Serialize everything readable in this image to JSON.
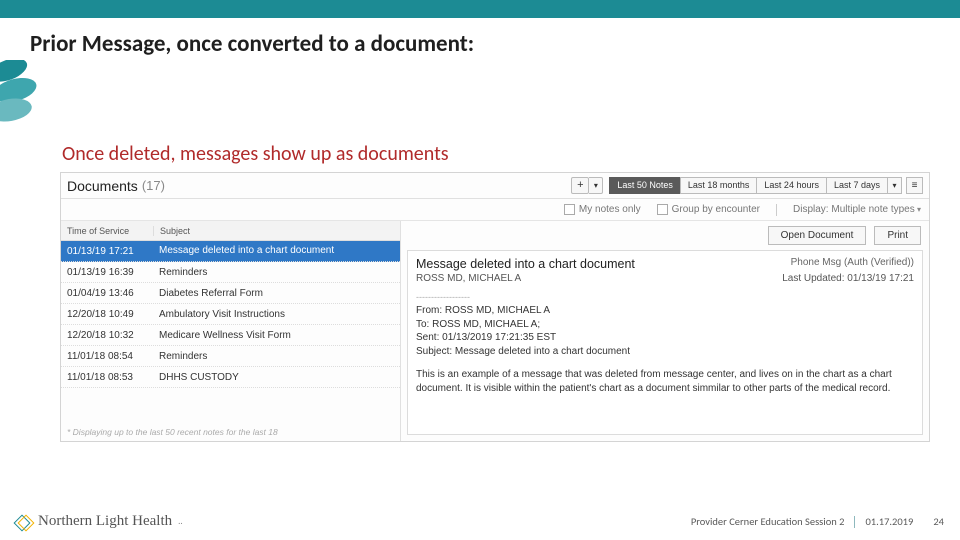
{
  "slide": {
    "title": "Prior Message, once converted to a document:",
    "subtitle": "Once deleted, messages show up as documents"
  },
  "docs_header": {
    "label": "Documents",
    "count": "(17)",
    "segments": [
      "Last 50 Notes",
      "Last 18 months",
      "Last 24 hours",
      "Last 7 days"
    ]
  },
  "filters": {
    "my_notes": "My notes only",
    "group_by": "Group by encounter",
    "display": "Display: Multiple note types"
  },
  "columns": {
    "c1": "Time of Service",
    "c2": "Subject"
  },
  "rows": [
    {
      "time": "01/13/19 17:21",
      "subject": "Message deleted into a chart document",
      "selected": true
    },
    {
      "time": "01/13/19 16:39",
      "subject": "Reminders"
    },
    {
      "time": "01/04/19 13:46",
      "subject": "Diabetes Referral Form"
    },
    {
      "time": "12/20/18 10:49",
      "subject": "Ambulatory Visit Instructions"
    },
    {
      "time": "12/20/18 10:32",
      "subject": "Medicare Wellness Visit Form"
    },
    {
      "time": "11/01/18 08:54",
      "subject": "Reminders"
    },
    {
      "time": "11/01/18 08:53",
      "subject": "DHHS CUSTODY"
    }
  ],
  "disclaimer": "* Displaying up to the last 50 recent notes for the last 18",
  "actions": {
    "open": "Open Document",
    "print": "Print"
  },
  "preview": {
    "title": "Message deleted into a chart document",
    "type": "Phone Msg (Auth (Verified))",
    "author": "ROSS MD, MICHAEL A",
    "last_updated": "Last Updated: 01/13/19 17:21",
    "dash": "------------------",
    "from": "From: ROSS MD, MICHAEL A",
    "to": "To: ROSS MD, MICHAEL A;",
    "sent": "Sent: 01/13/2019 17:21:35 EST",
    "subject": "Subject: Message deleted into a chart document",
    "body": "This is an example of a message that was deleted from message center, and lives on in the chart as a chart document. It is visible within the patient's chart as a document simmilar to other parts of the medical record."
  },
  "footer": {
    "brand": "Northern Light Health",
    "suffix": "..",
    "session": "Provider Cerner Education Session 2",
    "date": "01.17.2019",
    "page": "24"
  }
}
